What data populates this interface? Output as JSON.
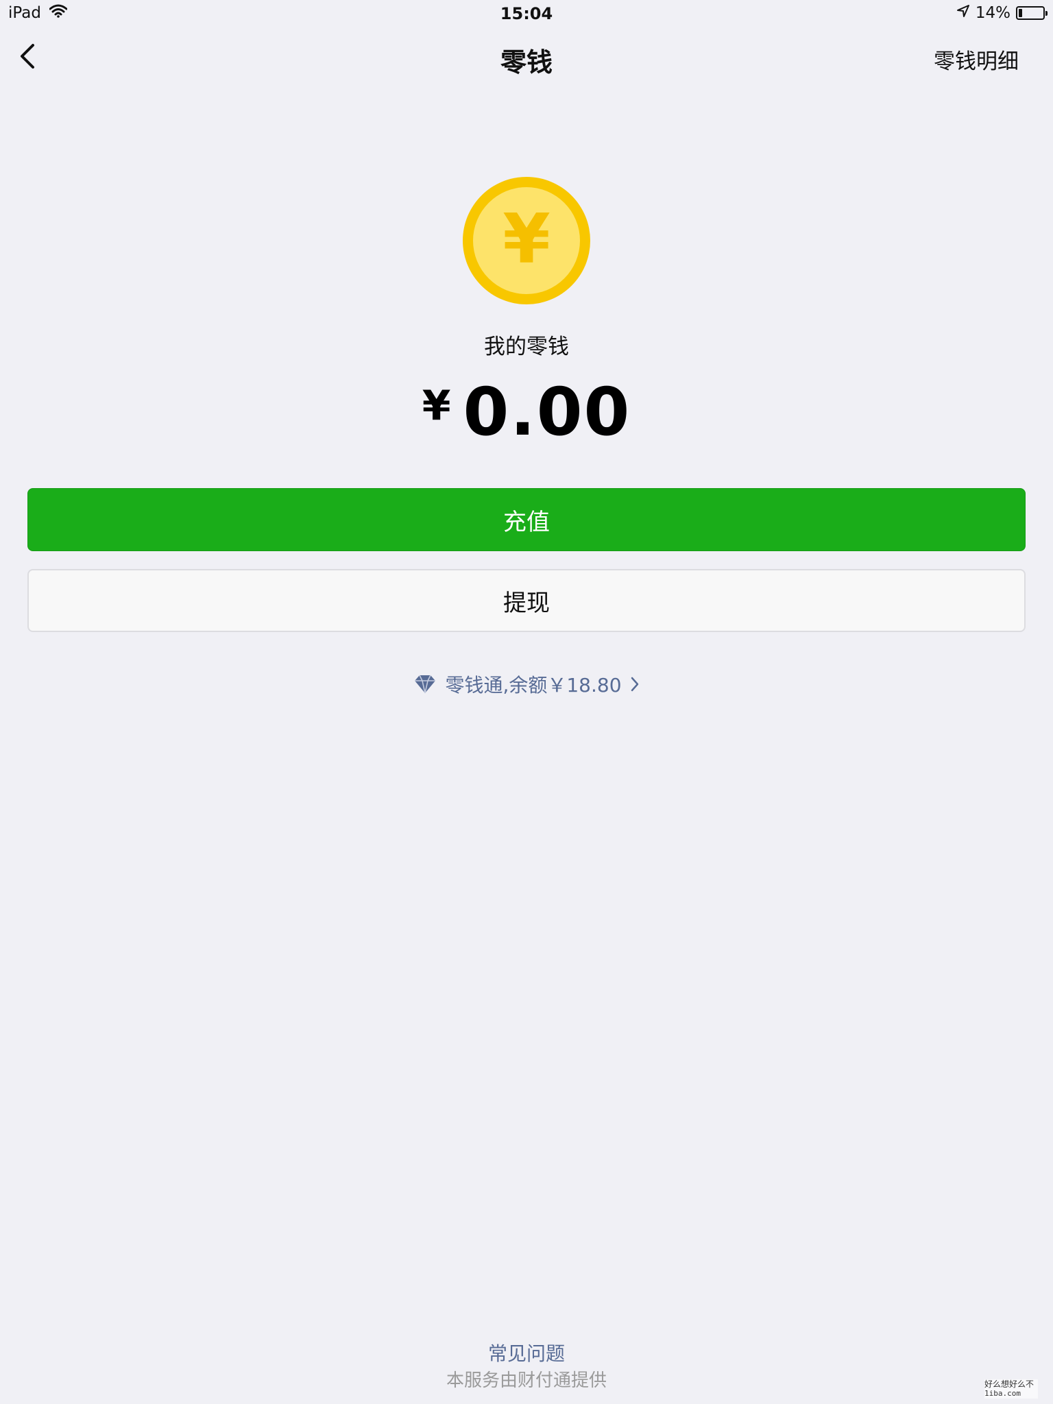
{
  "status_bar": {
    "device": "iPad",
    "time": "15:04",
    "battery_percent": "14%",
    "battery_level": 0.14
  },
  "nav": {
    "title": "零钱",
    "right_link": "零钱明细"
  },
  "wallet": {
    "label": "我的零钱",
    "currency_symbol": "¥",
    "amount": "0.00",
    "coin_symbol": "¥"
  },
  "actions": {
    "recharge_label": "充值",
    "withdraw_label": "提现"
  },
  "lingqiantong": {
    "text": "零钱通,余额￥18.80"
  },
  "footer": {
    "faq_label": "常见问题",
    "provider_text": "本服务由财付通提供"
  },
  "watermark": {
    "line1": "好么想好么不",
    "line2": "1iba.com"
  },
  "colors": {
    "accent_green": "#1aad19",
    "link_blue": "#576b95",
    "coin_outer": "#f8c700",
    "coin_inner": "#fde36a",
    "background": "#f0f0f5"
  }
}
